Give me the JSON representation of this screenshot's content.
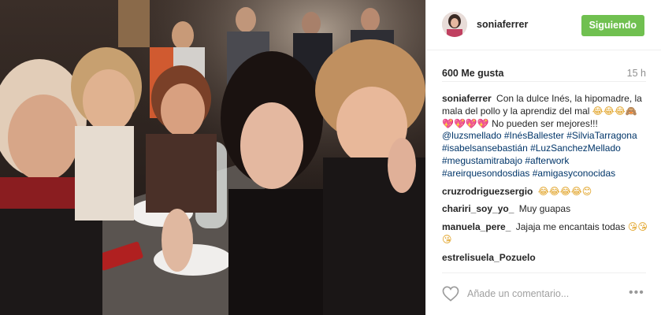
{
  "post": {
    "username": "soniaferrer",
    "follow_label": "Siguiendo",
    "likes": "600 Me gusta",
    "time_ago": "15 h"
  },
  "caption": {
    "author": "soniaferrer",
    "text_1": "Con la dulce Inés, la hipomadre, la mala del pollo y la aprendiz del mal",
    "emojis": "😂😂😂🙈",
    "hearts": "💖💖💖💖",
    "text_2": "No pueden ser mejores!!! ",
    "hashtags": "@luzsmellado #InésBallester #SilviaTarragona #isabelsansebastián #LuzSanchezMellado #megustamitrabajo #afterwork #areirquesondosdias #amigasyconocidas"
  },
  "comments": [
    {
      "author": "cruzrodriguezsergio",
      "text": "",
      "emoji": "😂😂😂😂😊"
    },
    {
      "author": "chariri_soy_yo_",
      "text": "Muy guapas",
      "emoji": ""
    },
    {
      "author": "manuela_pere_",
      "text": "Jajaja me encantais todas",
      "emoji": "😘😘😘"
    },
    {
      "author": "estrelisuela_Pozuelo",
      "text": "",
      "emoji": ""
    }
  ],
  "add_comment": {
    "placeholder": "Añade un comentario..."
  },
  "icons": {
    "like": "heart-outline-icon",
    "more": "more-options-icon"
  },
  "colors": {
    "follow_button": "#70c050",
    "hashtag": "#003569",
    "muted": "#8f8f8f"
  }
}
